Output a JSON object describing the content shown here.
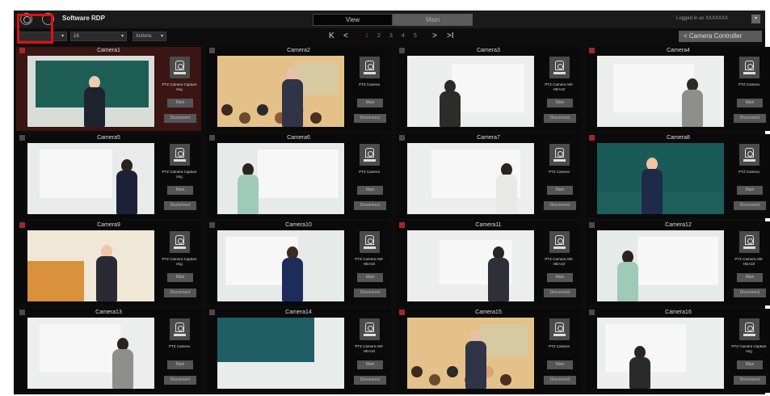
{
  "app": {
    "title": "Software RDP",
    "tabs": [
      "View",
      "Main"
    ],
    "login_status": "Logged in as XXXXXXX"
  },
  "toolbar": {
    "layout_select": "",
    "count_select": "16",
    "action_select": "Actions",
    "pager": {
      "first": "K",
      "prev": "<",
      "pages": [
        "1",
        "2",
        "3",
        "4",
        "5"
      ],
      "active_page": "1",
      "next": ">",
      "last": ">I"
    },
    "camera_controller": "< Camera Controller"
  },
  "colors": {
    "selected": "#3b1414",
    "accent_red": "#a02828",
    "highlight": "#e01010"
  },
  "cameras": [
    {
      "name": "Camera1",
      "type": "PTZ Camera Capture Img",
      "main": "Main",
      "disconnect": "Disconnect",
      "status": "red",
      "scene": "green-board"
    },
    {
      "name": "Camera2",
      "type": "PTZ Camera",
      "main": "Main",
      "disconnect": "Disconnect",
      "status": "gray",
      "scene": "lecture-hall"
    },
    {
      "name": "Camera3",
      "type": "PTZ Camera AW-HEA10",
      "main": "Main",
      "disconnect": "Disconnect",
      "status": "gray",
      "scene": "whiteboard-dark"
    },
    {
      "name": "Camera4",
      "type": "PTZ Camera",
      "main": "Main",
      "disconnect": "Disconnect",
      "status": "red",
      "scene": "whiteboard-gray"
    },
    {
      "name": "Camera5",
      "type": "PTZ Camera Capture Img",
      "main": "Main",
      "disconnect": "Disconnect",
      "status": "gray",
      "scene": "whiteboard-navy"
    },
    {
      "name": "Camera6",
      "type": "PTZ Camera",
      "main": "Main",
      "disconnect": "Disconnect",
      "status": "gray",
      "scene": "whiteboard-mint"
    },
    {
      "name": "Camera7",
      "type": "PTZ Camera",
      "main": "Main",
      "disconnect": "Disconnect",
      "status": "gray",
      "scene": "whiteboard-white"
    },
    {
      "name": "Camera8",
      "type": "PTZ Camera",
      "main": "Main",
      "disconnect": "Disconnect",
      "status": "red",
      "scene": "closeup-board"
    },
    {
      "name": "Camera9",
      "type": "PTZ Camera Capture Img",
      "main": "Main",
      "disconnect": "Disconnect",
      "status": "red",
      "scene": "presenter-wood"
    },
    {
      "name": "Camera10",
      "type": "PTZ Camera AW-HEA10",
      "main": "Main",
      "disconnect": "Disconnect",
      "status": "gray",
      "scene": "whiteboard-navy2"
    },
    {
      "name": "Camera11",
      "type": "PTZ Camera AW-HEA10",
      "main": "Main",
      "disconnect": "Disconnect",
      "status": "red",
      "scene": "whiteboard-far"
    },
    {
      "name": "Camera12",
      "type": "PTZ Camera AW-HEA10",
      "main": "Main",
      "disconnect": "Disconnect",
      "status": "gray",
      "scene": "whiteboard-mint2"
    },
    {
      "name": "Camera13",
      "type": "PTZ Camera",
      "main": "Main",
      "disconnect": "Disconnect",
      "status": "gray",
      "scene": "whiteboard-gray2"
    },
    {
      "name": "Camera14",
      "type": "PTZ Camera AW-HEA10",
      "main": "Main",
      "disconnect": "Disconnect",
      "status": "gray",
      "scene": "empty-board"
    },
    {
      "name": "Camera15",
      "type": "PTZ Camera",
      "main": "Main",
      "disconnect": "Disconnect",
      "status": "red",
      "scene": "lecture-hall2"
    },
    {
      "name": "Camera16",
      "type": "PTZ Camera Capture Img",
      "main": "Main",
      "disconnect": "Disconnect",
      "status": "gray",
      "scene": "whiteboard-dark2"
    }
  ]
}
